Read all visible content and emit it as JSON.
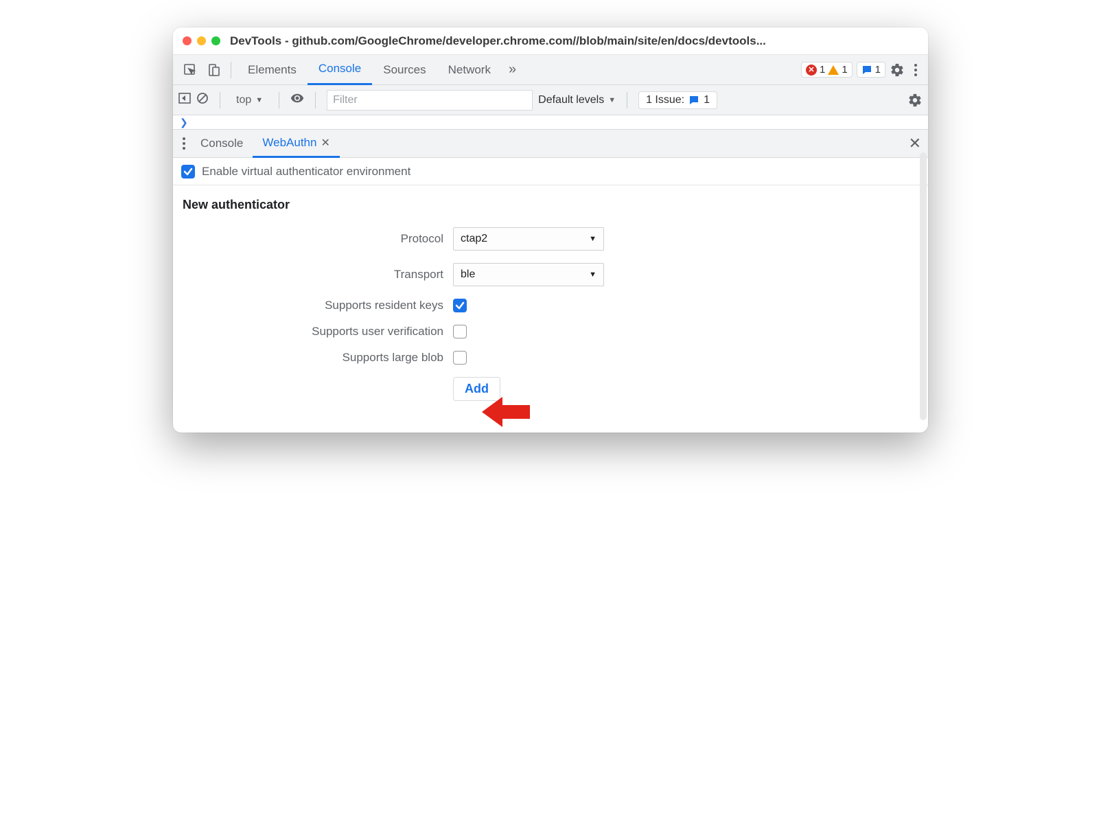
{
  "window": {
    "title": "DevTools - github.com/GoogleChrome/developer.chrome.com//blob/main/site/en/docs/devtools..."
  },
  "tabs": {
    "elements": "Elements",
    "console": "Console",
    "sources": "Sources",
    "network": "Network"
  },
  "status": {
    "errors": "1",
    "warnings": "1",
    "issues_top": "1"
  },
  "console_toolbar": {
    "context": "top",
    "filter_placeholder": "Filter",
    "levels": "Default levels",
    "issues_label": "1 Issue:",
    "issues_count": "1"
  },
  "drawer": {
    "console": "Console",
    "webauthn": "WebAuthn"
  },
  "webauthn": {
    "enable_label": "Enable virtual authenticator environment",
    "enable_checked": true,
    "heading": "New authenticator",
    "protocol_label": "Protocol",
    "protocol_value": "ctap2",
    "transport_label": "Transport",
    "transport_value": "ble",
    "resident_label": "Supports resident keys",
    "resident_checked": true,
    "uv_label": "Supports user verification",
    "uv_checked": false,
    "blob_label": "Supports large blob",
    "blob_checked": false,
    "add_label": "Add"
  }
}
